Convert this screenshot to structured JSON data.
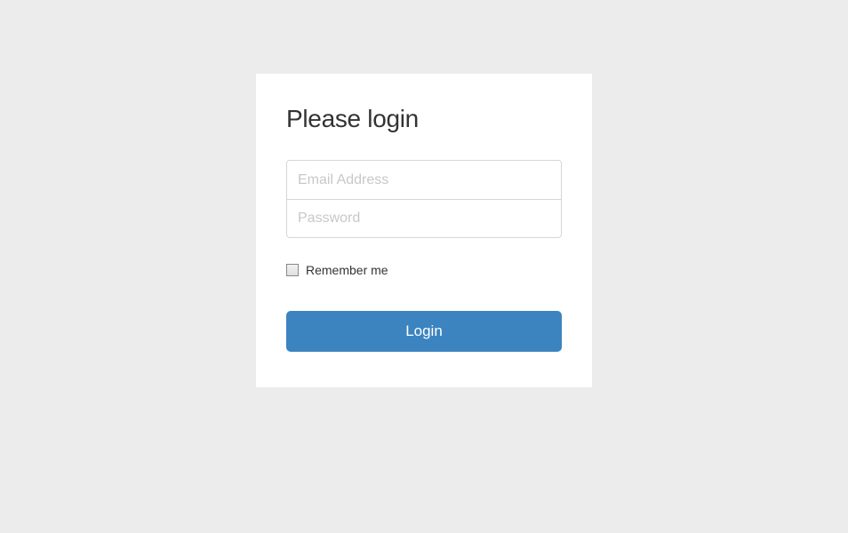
{
  "login": {
    "title": "Please login",
    "email_placeholder": "Email Address",
    "password_placeholder": "Password",
    "remember_label": "Remember me",
    "button_label": "Login"
  }
}
